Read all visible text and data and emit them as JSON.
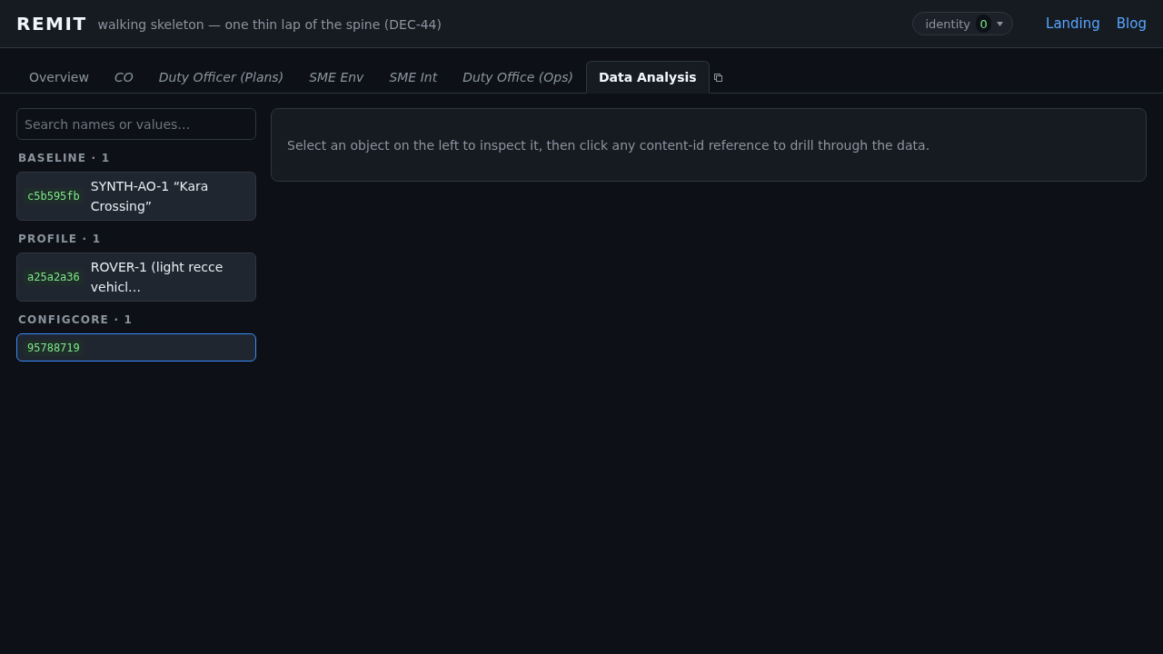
{
  "header": {
    "logo": "REMIT",
    "subtitle": "walking skeleton — one thin lap of the spine (DEC-44)",
    "identity": {
      "label": "identity",
      "count": "0"
    },
    "links": [
      "Landing",
      "Blog"
    ]
  },
  "tabs": [
    {
      "label": "Overview",
      "kind": "plain",
      "selected": false
    },
    {
      "label": "CO",
      "kind": "role",
      "selected": false
    },
    {
      "label": "Duty Officer (Plans)",
      "kind": "role",
      "selected": false
    },
    {
      "label": "SME Env",
      "kind": "role",
      "selected": false
    },
    {
      "label": "SME Int",
      "kind": "role",
      "selected": false
    },
    {
      "label": "Duty Office (Ops)",
      "kind": "role",
      "selected": false
    },
    {
      "label": "Data Analysis",
      "kind": "plain",
      "selected": true
    }
  ],
  "sidebar": {
    "search": {
      "placeholder": "Search names or values…"
    },
    "groups": [
      {
        "title": "BASELINE · 1",
        "items": [
          {
            "id": "c5b595fb",
            "name": "SYNTH-AO-1 “Kara Crossing”",
            "selected": false
          }
        ]
      },
      {
        "title": "PROFILE · 1",
        "items": [
          {
            "id": "a25a2a36",
            "name": "ROVER-1 (light recce vehicl…",
            "selected": false
          }
        ]
      },
      {
        "title": "CONFIGCORE · 1",
        "items": [
          {
            "id": "95788719",
            "selected": true
          }
        ]
      }
    ]
  },
  "detail": {
    "message": "Select an object on the left to inspect it, then click any content-id reference to drill through the data."
  }
}
